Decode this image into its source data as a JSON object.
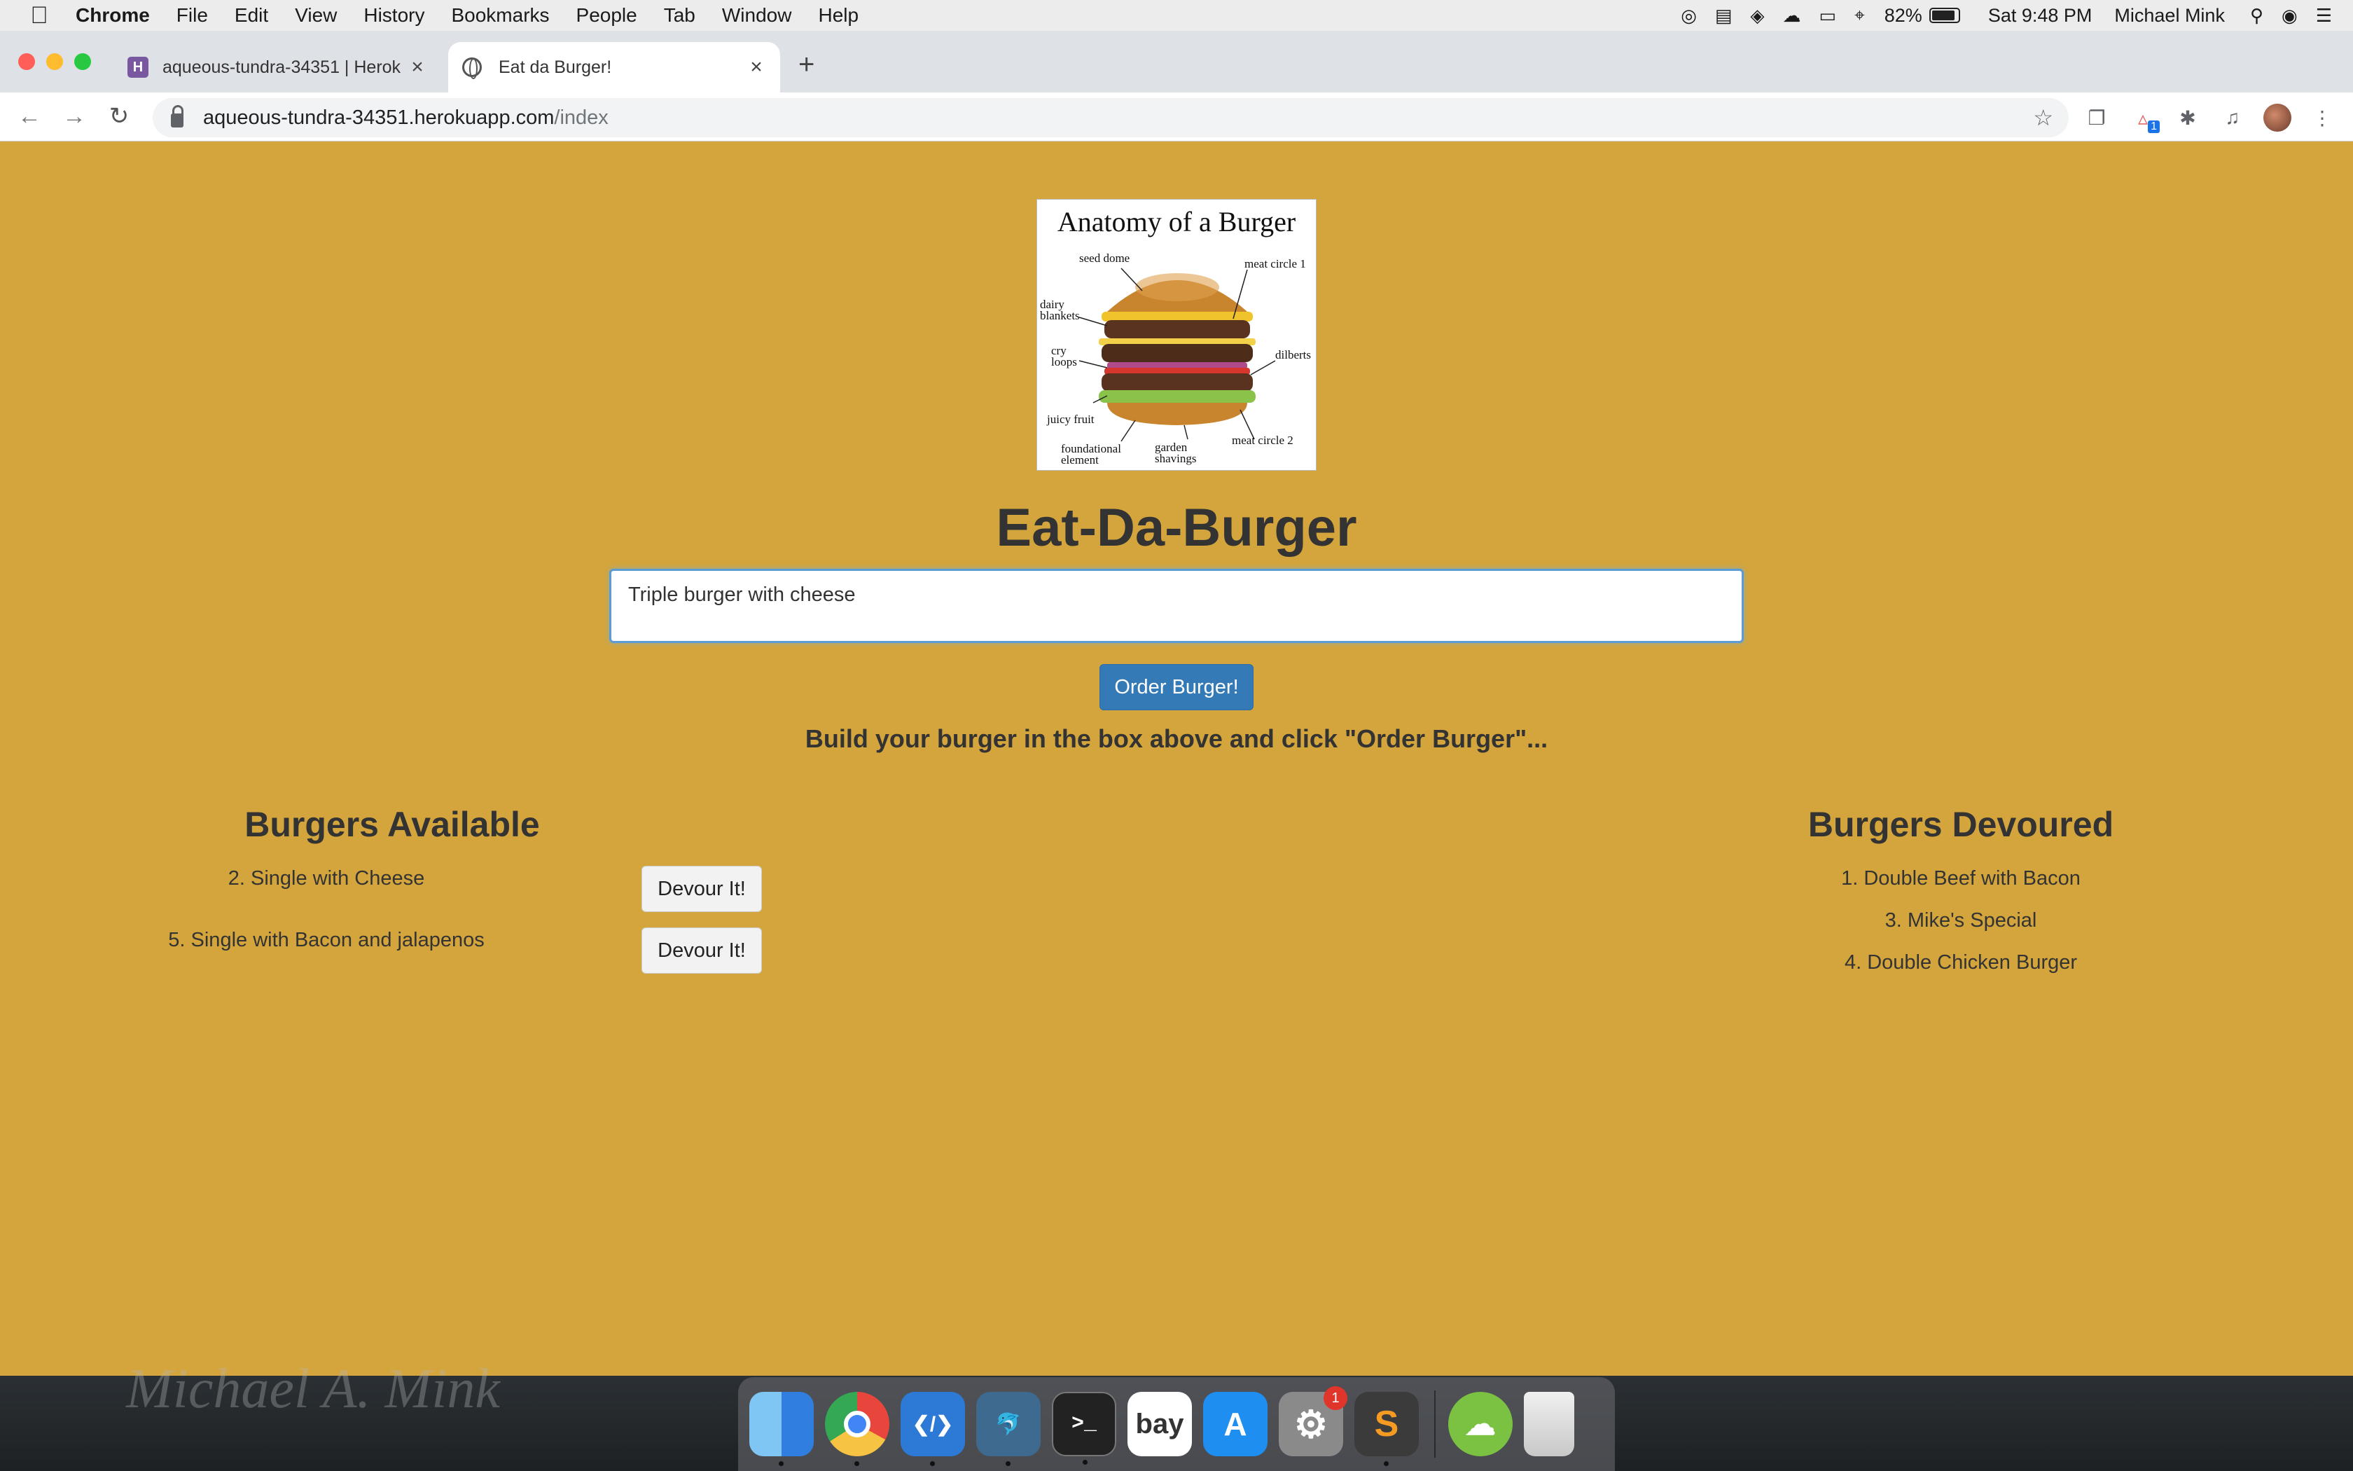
{
  "menubar": {
    "app_name": "Chrome",
    "items": [
      "File",
      "Edit",
      "View",
      "History",
      "Bookmarks",
      "People",
      "Tab",
      "Window",
      "Help"
    ],
    "battery": "82%",
    "clock": "Sat 9:48 PM",
    "user": "Michael Mink"
  },
  "browser": {
    "tabs": [
      {
        "title": "aqueous-tundra-34351 | Herok",
        "icon": "heroku-icon"
      },
      {
        "title": "Eat da Burger!",
        "icon": "globe-icon"
      }
    ],
    "url_host": "aqueous-tundra-34351.herokuapp.com",
    "url_path": "/index",
    "extension_badge": "1"
  },
  "page": {
    "image": {
      "title": "Anatomy of a Burger",
      "labels": [
        "seed dome",
        "meat circle 1",
        "dairy blankets",
        "cry loops",
        "dilberts",
        "juicy fruit",
        "foundational element",
        "garden shavings",
        "meat circle 2"
      ]
    },
    "heading": "Eat-Da-Burger",
    "input_value": "Triple burger with cheese",
    "order_button": "Order Burger!",
    "instructions": "Build your burger in the box above and click \"Order Burger\"...",
    "available_title": "Burgers Available",
    "available": [
      {
        "label": "2. Single with Cheese",
        "button": "Devour It!"
      },
      {
        "label": "5. Single with Bacon and jalapenos",
        "button": "Devour It!"
      }
    ],
    "devoured_title": "Burgers Devoured",
    "devoured": [
      "1. Double Beef with Bacon",
      "3. Mike's Special",
      "4. Double Chicken Burger"
    ]
  },
  "desktop": {
    "signature": "Michael A. Mink",
    "dock": [
      {
        "name": "finder-icon",
        "color": "#3a8ee6"
      },
      {
        "name": "chrome-icon",
        "color": "#e8453c"
      },
      {
        "name": "vscode-icon",
        "color": "#2c7ad6"
      },
      {
        "name": "mysql-workbench-icon",
        "color": "#3e6a8f"
      },
      {
        "name": "terminal-icon",
        "color": "#222222"
      },
      {
        "name": "ebay-icon",
        "color": "#ffffff"
      },
      {
        "name": "app-store-icon",
        "color": "#1f8ef1"
      },
      {
        "name": "system-preferences-icon",
        "color": "#8a8a8a",
        "badge": "1"
      },
      {
        "name": "sublime-text-icon",
        "color": "#3b3b3b"
      },
      {
        "name": "download-cloud-icon",
        "color": "#7cc242"
      },
      {
        "name": "trash-icon",
        "color": "#d9d9d9"
      }
    ]
  }
}
